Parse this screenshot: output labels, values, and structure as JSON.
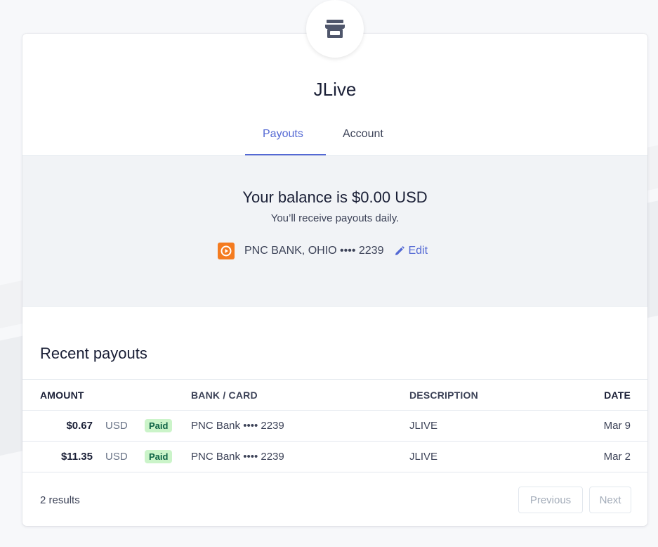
{
  "merchant": {
    "name": "JLive",
    "avatar_icon": "storefront-icon"
  },
  "tabs": [
    {
      "label": "Payouts",
      "active": true
    },
    {
      "label": "Account",
      "active": false
    }
  ],
  "balance": {
    "headline": "Your balance is $0.00 USD",
    "schedule": "You’ll receive payouts daily.",
    "bank_label": "PNC BANK, OHIO •••• 2239",
    "edit_label": "Edit",
    "bank_logo_color": "#f47b20"
  },
  "recent": {
    "title": "Recent payouts",
    "columns": {
      "amount": "AMOUNT",
      "bank": "BANK / CARD",
      "description": "DESCRIPTION",
      "date": "DATE"
    },
    "rows": [
      {
        "amount": "$0.67",
        "currency": "USD",
        "status": "Paid",
        "bank": "PNC Bank  •••• 2239",
        "description": "JLIVE",
        "date": "Mar 9"
      },
      {
        "amount": "$11.35",
        "currency": "USD",
        "status": "Paid",
        "bank": "PNC Bank  •••• 2239",
        "description": "JLIVE",
        "date": "Mar 2"
      }
    ],
    "result_count": "2 results",
    "prev_label": "Previous",
    "next_label": "Next"
  },
  "colors": {
    "accent": "#5469d4",
    "paid_bg": "#cbf4c9",
    "paid_text": "#0e6245"
  }
}
